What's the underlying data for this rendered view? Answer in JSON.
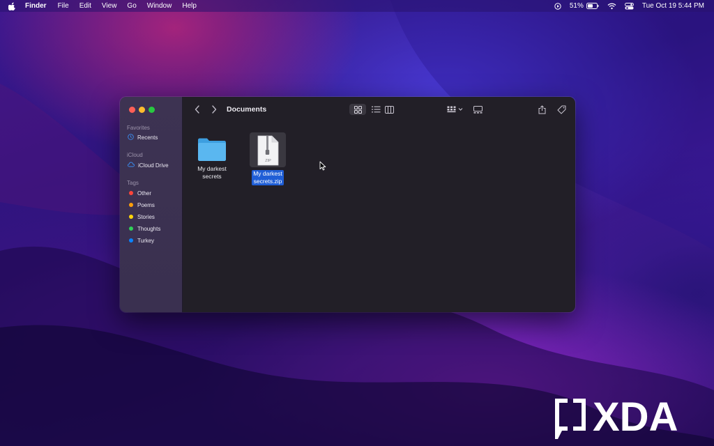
{
  "menubar": {
    "app_name": "Finder",
    "items": [
      "File",
      "Edit",
      "View",
      "Go",
      "Window",
      "Help"
    ],
    "battery_percent": "51%",
    "datetime": "Tue Oct 19  5:44 PM",
    "icons": [
      "apple-icon",
      "screen-recording-icon",
      "battery-icon",
      "wifi-icon",
      "control-center-icon"
    ]
  },
  "window": {
    "title": "Documents",
    "toolbar_icons": [
      "back-icon",
      "forward-icon",
      "icon-view-icon",
      "list-view-icon",
      "column-view-icon",
      "gallery-view-icon",
      "group-icon",
      "share-icon",
      "tag-icon",
      "more-actions-icon",
      "search-icon"
    ],
    "sidebar": {
      "favorites_heading": "Favorites",
      "favorites": [
        {
          "label": "Recents",
          "icon": "clock-icon"
        }
      ],
      "icloud_heading": "iCloud",
      "icloud": [
        {
          "label": "iCloud Drive",
          "icon": "cloud-icon"
        }
      ],
      "tags_heading": "Tags",
      "tags": [
        {
          "label": "Other",
          "color": "#ff453a"
        },
        {
          "label": "Poems",
          "color": "#ff9f0a"
        },
        {
          "label": "Stories",
          "color": "#ffd60a"
        },
        {
          "label": "Thoughts",
          "color": "#30d158"
        },
        {
          "label": "Turkey",
          "color": "#0a84ff"
        }
      ]
    },
    "files": [
      {
        "line1": "My darkest",
        "line2": "secrets",
        "type": "folder",
        "selected": false
      },
      {
        "line1": "My darkest",
        "line2": "secrets.zip",
        "type": "zip",
        "badge": "ZIP",
        "selected": true
      }
    ]
  },
  "watermark": {
    "text": "XDA"
  },
  "colors": {
    "selection": "#1f5ed6",
    "folder": "#5ab7f0"
  }
}
